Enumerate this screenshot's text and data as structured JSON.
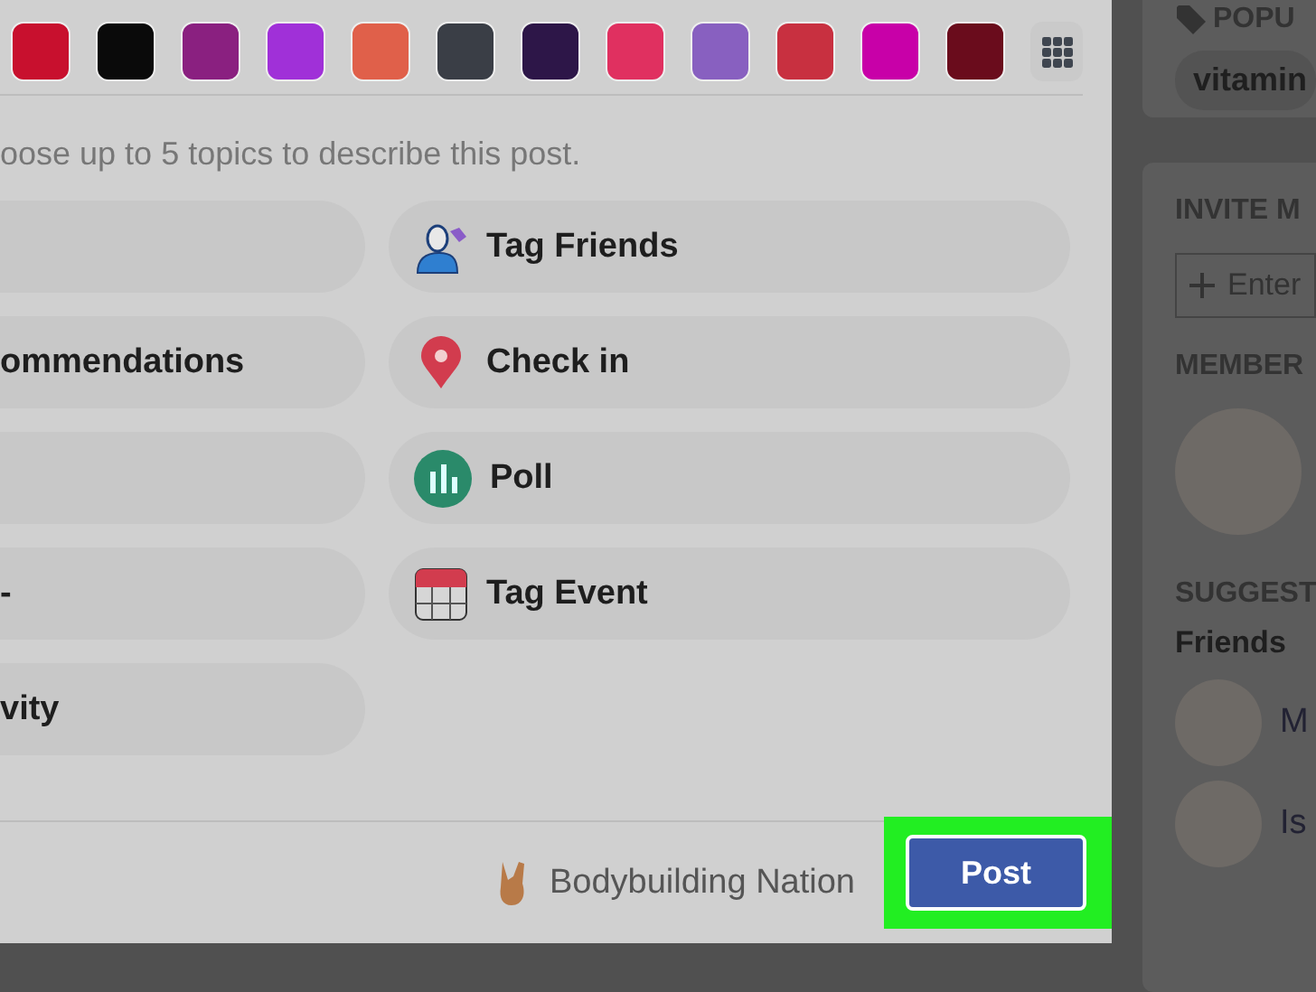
{
  "backgrounds": [
    {
      "color": "#c8102e"
    },
    {
      "color": "#0a0a0a"
    },
    {
      "color": "#8a2080"
    },
    {
      "color": "#a030d8"
    },
    {
      "color": "#e0604a"
    },
    {
      "color": "#3a3e46"
    },
    {
      "color": "#2d1648"
    },
    {
      "color": "#e03060"
    },
    {
      "color": "#8860c0"
    },
    {
      "color": "#c83040"
    },
    {
      "color": "#c800a8"
    },
    {
      "color": "#6a0c1c"
    }
  ],
  "hint": "oose up to 5 topics to describe this post.",
  "left_options": [
    {
      "kind": "blank"
    },
    {
      "kind": "text",
      "label": "ommendations"
    },
    {
      "kind": "blank"
    },
    {
      "kind": "text",
      "label": "-"
    },
    {
      "kind": "text",
      "label": "vity"
    }
  ],
  "right_options": [
    {
      "kind": "tag-friends",
      "label": "Tag Friends"
    },
    {
      "kind": "check-in",
      "label": "Check in"
    },
    {
      "kind": "poll",
      "label": "Poll"
    },
    {
      "kind": "event",
      "label": "Tag Event"
    }
  ],
  "footer": {
    "group": "Bodybuilding Nation",
    "post_button": "Post",
    "highlighted": true
  },
  "sidebar": {
    "popular_heading": "POPU",
    "popular_tag": "vitamin",
    "invite_heading": "INVITE M",
    "invite_placeholder": "Enter",
    "members_heading": "MEMBER",
    "suggested_heading": "SUGGEST",
    "friends_label": "Friends",
    "friends": [
      {
        "name": "M"
      },
      {
        "name": "Is"
      }
    ]
  }
}
